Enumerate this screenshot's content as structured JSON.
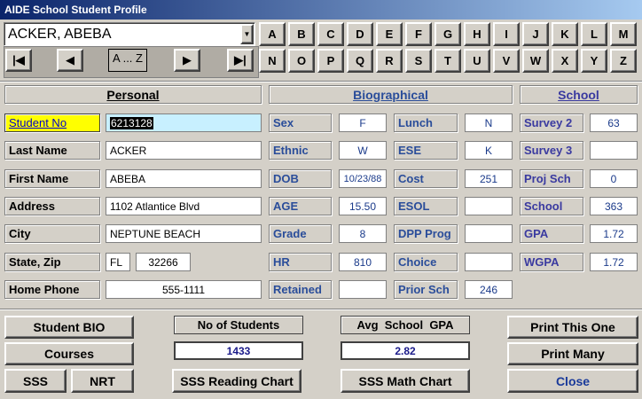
{
  "window": {
    "title": "AIDE School Student Profile"
  },
  "student_select": {
    "value": "ACKER, ABEBA"
  },
  "letters_row1": [
    "A",
    "B",
    "C",
    "D",
    "E",
    "F",
    "G",
    "H",
    "I",
    "J",
    "K",
    "L",
    "M"
  ],
  "letters_row2": [
    "N",
    "O",
    "P",
    "Q",
    "R",
    "S",
    "T",
    "U",
    "V",
    "W",
    "X",
    "Y",
    "Z"
  ],
  "nav": {
    "first": "|◀",
    "prev": "◀",
    "az": "A ... Z",
    "next": "▶",
    "last": "▶|"
  },
  "sections": {
    "personal": "Personal",
    "biographical": "Biographical",
    "school": "School"
  },
  "personal": {
    "student_no_label": "Student No",
    "student_no": "6213128",
    "last_name_label": "Last Name",
    "last_name": "ACKER",
    "first_name_label": "First Name",
    "first_name": "ABEBA",
    "address_label": "Address",
    "address": "1102 Atlantice Blvd",
    "city_label": "City",
    "city": "NEPTUNE BEACH",
    "state_zip_label": "State, Zip",
    "state": "FL",
    "zip": "32266",
    "phone_label": "Home Phone",
    "phone": "555-1111"
  },
  "bio": {
    "sex_label": "Sex",
    "sex": "F",
    "ethnic_label": "Ethnic",
    "ethnic": "W",
    "dob_label": "DOB",
    "dob": "10/23/88",
    "age_label": "AGE",
    "age": "15.50",
    "grade_label": "Grade",
    "grade": "8",
    "hr_label": "HR",
    "hr": "810",
    "retained_label": "Retained",
    "retained": "",
    "lunch_label": "Lunch",
    "lunch": "N",
    "ese_label": "ESE",
    "ese": "K",
    "cost_label": "Cost",
    "cost": "251",
    "esol_label": "ESOL",
    "esol": "",
    "dpp_label": "DPP Prog",
    "dpp": "",
    "choice_label": "Choice",
    "choice": "",
    "prior_label": "Prior Sch",
    "prior": "246"
  },
  "school": {
    "survey2_label": "Survey 2",
    "survey2": "63",
    "survey3_label": "Survey 3",
    "survey3": "",
    "proj_label": "Proj Sch",
    "proj": "0",
    "school_label": "School",
    "school": "363",
    "gpa_label": "GPA",
    "gpa": "1.72",
    "wgpa_label": "WGPA",
    "wgpa": "1.72"
  },
  "footer": {
    "student_bio": "Student BIO",
    "courses": "Courses",
    "sss": "SSS",
    "nrt": "NRT",
    "num_students_label": "No of Students",
    "num_students": "1433",
    "reading_chart": "SSS Reading Chart",
    "avg_gpa_label": "Avg  School  GPA",
    "avg_gpa": "2.82",
    "math_chart": "SSS Math Chart",
    "print_one": "Print This One",
    "print_many": "Print Many",
    "close": "Close"
  }
}
